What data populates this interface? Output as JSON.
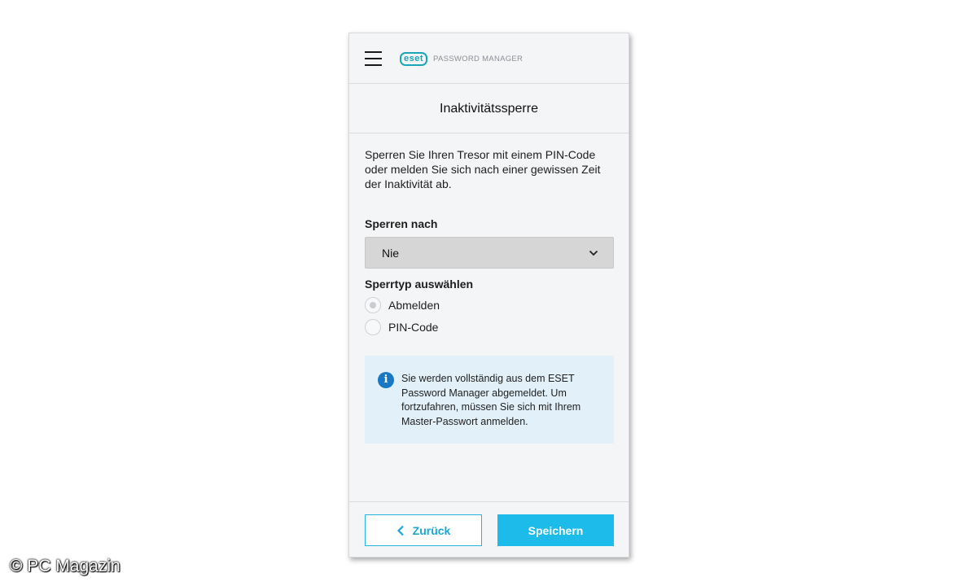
{
  "header": {
    "logo_badge": "eset",
    "logo_text": "PASSWORD MANAGER",
    "menu_icon": "hamburger-menu-icon"
  },
  "page": {
    "title": "Inaktivitätssperre",
    "description": "Sperren Sie Ihren Tresor mit einem PIN-Code oder melden Sie sich nach einer gewissen Zeit der Inaktivität ab."
  },
  "lock_after": {
    "label": "Sperren nach",
    "selected": "Nie",
    "icon": "chevron-down-icon"
  },
  "lock_type": {
    "label": "Sperrtyp auswählen",
    "options": [
      {
        "label": "Abmelden",
        "checked": true
      },
      {
        "label": "PIN-Code",
        "checked": false
      }
    ]
  },
  "info": {
    "icon": "info-icon",
    "text": "Sie werden vollständig aus dem ESET Password Manager abgemeldet. Um fortzufahren, müssen Sie sich mit Ihrem Master-Passwort anmelden."
  },
  "footer": {
    "back_label": "Zurück",
    "save_label": "Speichern"
  },
  "colors": {
    "accent": "#1dbbea",
    "brand": "#1aa6b7",
    "info_bg": "#e2f1f9"
  },
  "watermark": "© PC Magazin"
}
